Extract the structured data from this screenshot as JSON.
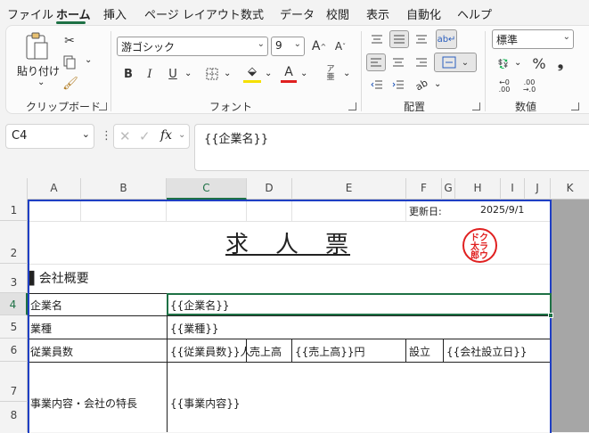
{
  "menu": {
    "items": [
      "ファイル",
      "ホーム",
      "挿入",
      "ページ レイアウト",
      "数式",
      "データ",
      "校閲",
      "表示",
      "自動化",
      "ヘルプ"
    ],
    "active": "ホーム"
  },
  "ribbon": {
    "clipboard": {
      "paste_label": "貼り付け",
      "group_label": "クリップボード"
    },
    "font": {
      "font_name": "游ゴシック",
      "font_size": "9",
      "group_label": "フォント"
    },
    "alignment": {
      "group_label": "配置"
    },
    "number": {
      "format": "標準",
      "group_label": "数値"
    }
  },
  "formula_bar": {
    "name_box": "C4",
    "fx": "fx",
    "formula": "{{企業名}}"
  },
  "columns": [
    "A",
    "B",
    "C",
    "D",
    "E",
    "F",
    "G",
    "H",
    "I",
    "J",
    "K"
  ],
  "selected_column": "C",
  "rows": [
    "1",
    "2",
    "3",
    "4",
    "5",
    "6",
    "7",
    "8"
  ],
  "selected_row": "4",
  "sheet": {
    "update_label": "更新日:",
    "update_date": "2025/9/1",
    "title": "求　人　票",
    "stamp_lines": [
      "ク",
      "ラ",
      "ウ",
      "ド",
      "太",
      "郎"
    ],
    "section_header": "▌会社概要",
    "labels": {
      "company": "企業名",
      "industry": "業種",
      "employees": "従業員数",
      "business": "事業内容・会社の特長"
    },
    "values": {
      "company": "{{企業名}}",
      "industry": "{{業種}}",
      "employees": "{{従業員数}}人",
      "sales_label": "売上高",
      "sales": "{{売上高}}円",
      "founded_label": "設立",
      "founded": "{{会社設立日}}",
      "business": "{{事業内容}}"
    }
  },
  "colors": {
    "accent": "#1e7145",
    "print_border": "#1f3fc4",
    "stamp": "#e02020"
  }
}
